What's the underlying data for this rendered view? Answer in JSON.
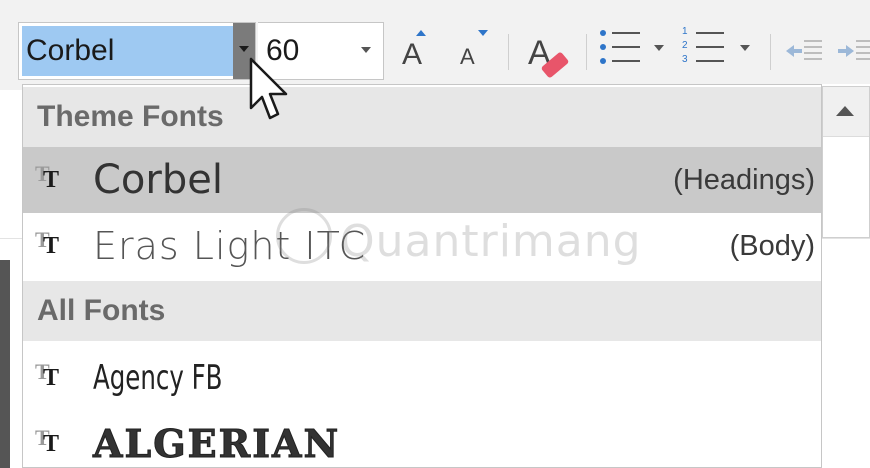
{
  "toolbar": {
    "font_name_value": "Corbel",
    "font_size_value": "60",
    "grow_font_glyph": "A",
    "shrink_font_glyph": "A",
    "clear_format_glyph": "A",
    "numbering_digits": [
      "1",
      "2",
      "3"
    ],
    "accent_color": "#2e75c9",
    "selection_color": "#9ec9f2"
  },
  "dropdown": {
    "theme_fonts_header": "Theme Fonts",
    "all_fonts_header": "All Fonts",
    "theme_fonts": [
      {
        "name": "Corbel",
        "role": "(Headings)",
        "selected": true,
        "icon": "truetype-icon"
      },
      {
        "name": "Eras Light ITC",
        "role": "(Body)",
        "selected": false,
        "icon": "truetype-icon"
      }
    ],
    "all_fonts": [
      {
        "name": "Agency FB",
        "icon": "truetype-icon"
      },
      {
        "name": "ALGERIAN",
        "icon": "truetype-icon"
      }
    ],
    "tt_glyph": "T"
  },
  "watermark": {
    "text": "Quantrimang",
    "logo": "quantrimang-logo"
  }
}
